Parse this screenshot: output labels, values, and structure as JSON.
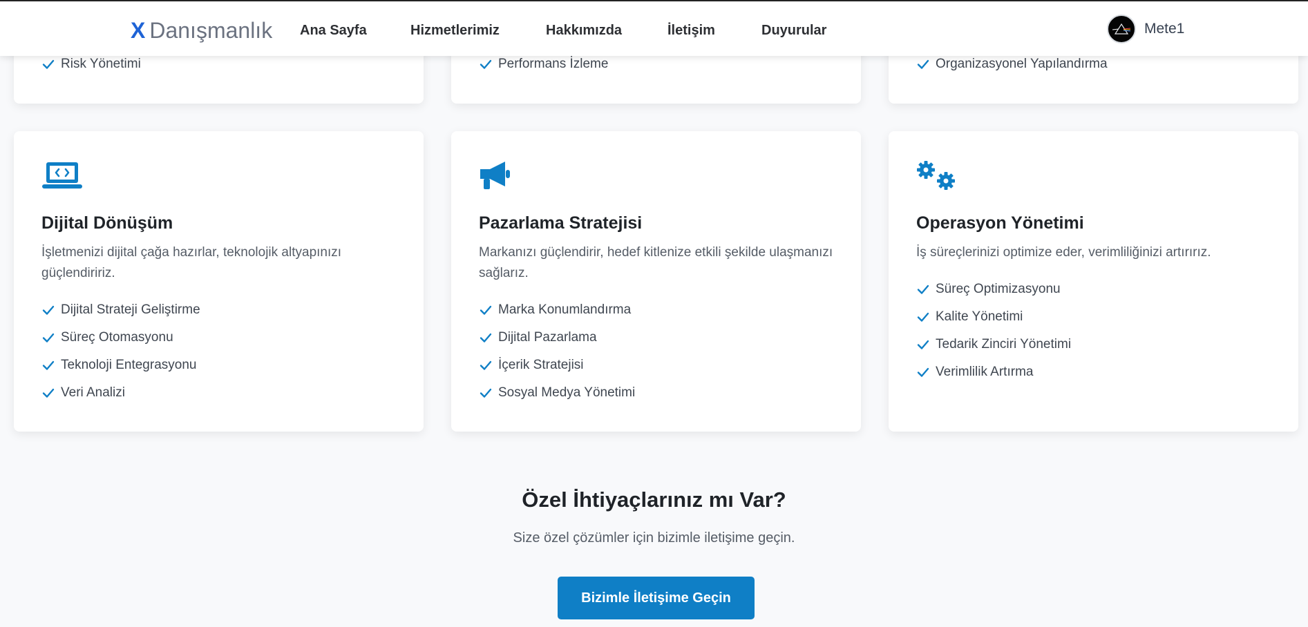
{
  "header": {
    "brand_x": "X",
    "brand_name": "Danışmanlık",
    "nav": [
      "Ana Sayfa",
      "Hizmetlerimiz",
      "Hakkımızda",
      "İletişim",
      "Duyurular"
    ],
    "user_name": "Mete1"
  },
  "top_cards": [
    "Risk Yönetimi",
    "Performans İzleme",
    "Organizasyonel Yapılandırma"
  ],
  "cards": [
    {
      "icon": "laptop-code-icon",
      "title": "Dijital Dönüşüm",
      "description": "İşletmenizi dijital çağa hazırlar, teknolojik altyapınızı güçlendiririz.",
      "features": [
        "Dijital Strateji Geliştirme",
        "Süreç Otomasyonu",
        "Teknoloji Entegrasyonu",
        "Veri Analizi"
      ]
    },
    {
      "icon": "bullhorn-icon",
      "title": "Pazarlama Stratejisi",
      "description": "Markanızı güçlendirir, hedef kitlenize etkili şekilde ulaşmanızı sağlarız.",
      "features": [
        "Marka Konumlandırma",
        "Dijital Pazarlama",
        "İçerik Stratejisi",
        "Sosyal Medya Yönetimi"
      ]
    },
    {
      "icon": "gears-icon",
      "title": "Operasyon Yönetimi",
      "description": "İş süreçlerinizi optimize eder, verimliliğinizi artırırız.",
      "features": [
        "Süreç Optimizasyonu",
        "Kalite Yönetimi",
        "Tedarik Zinciri Yönetimi",
        "Verimlilik Artırma"
      ]
    }
  ],
  "cta": {
    "title": "Özel İhtiyaçlarınız mı Var?",
    "subtitle": "Size özel çözümler için bizimle iletişime geçin.",
    "button": "Bizimle İletişime Geçin"
  },
  "colors": {
    "accent": "#0f7fc6",
    "brand_x": "#1e63d6",
    "page_bg": "#f8f9fb"
  }
}
